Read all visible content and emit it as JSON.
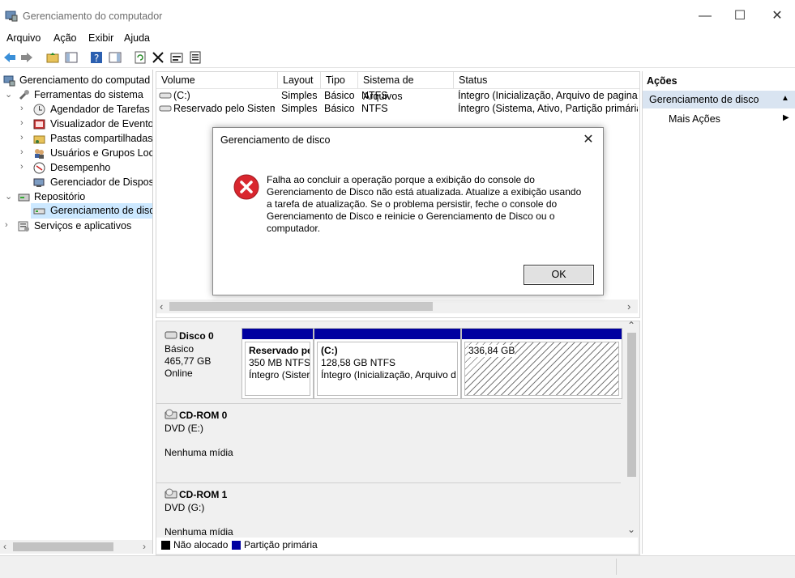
{
  "window": {
    "title": "Gerenciamento do computador",
    "minimize": "—",
    "maximize": "☐",
    "close": "✕"
  },
  "menu": [
    "Arquivo",
    "Ação",
    "Exibir",
    "Ajuda"
  ],
  "tree": {
    "root": "Gerenciamento do computad",
    "tools": "Ferramentas do sistema",
    "scheduler": "Agendador de Tarefas",
    "events": "Visualizador de Eventos",
    "shared": "Pastas compartilhadas",
    "users": "Usuários e Grupos Loca",
    "perf": "Desempenho",
    "devmgr": "Gerenciador de Disposit",
    "storage": "Repositório",
    "diskmgmt": "Gerenciamento de disco",
    "services": "Serviços e aplicativos"
  },
  "list": {
    "columns": [
      "Volume",
      "Layout",
      "Tipo",
      "Sistema de Arquivos",
      "Status"
    ],
    "rows": [
      [
        "(C:)",
        "Simples",
        "Básico",
        "NTFS",
        "Íntegro (Inicialização, Arquivo de paginaçã"
      ],
      [
        "Reservado pelo Sistema",
        "Simples",
        "Básico",
        "NTFS",
        "Íntegro (Sistema, Ativo, Partição primária)"
      ]
    ]
  },
  "disks": {
    "disk0": {
      "name": "Disco 0",
      "type": "Básico",
      "size": "465,77 GB",
      "state": "Online"
    },
    "p_reserved": {
      "title": "Reservado pe",
      "size": "350 MB NTFS",
      "status": "Íntegro (Sister"
    },
    "p_c": {
      "title": "(C:)",
      "size": "128,58 GB NTFS",
      "status": "Íntegro (Inicialização, Arquivo d"
    },
    "p_unalloc": {
      "size": "336,84 GB"
    },
    "cd0": {
      "name": "CD-ROM 0",
      "drive": "DVD (E:)",
      "media": "Nenhuma mídia"
    },
    "cd1": {
      "name": "CD-ROM 1",
      "drive": "DVD (G:)",
      "media": "Nenhuma mídia"
    }
  },
  "legend": {
    "unallocated": "Não alocado",
    "primary": "Partição primária"
  },
  "actions": {
    "header": "Ações",
    "section": "Gerenciamento de disco",
    "more": "Mais Ações"
  },
  "dialog": {
    "title": "Gerenciamento de disco",
    "message": "Falha ao concluir a operação porque a exibição do console do Gerenciamento de Disco não está atualizada. Atualize a exibição usando a tarefa de atualização. Se o problema persistir, feche o console do Gerenciamento de Disco e reinicie o Gerenciamento de Disco ou o computador.",
    "ok": "OK"
  },
  "colors": {
    "primary_partition": "#0000a0",
    "selected_bg": "#cce8ff",
    "section_bg": "#d9e4f1",
    "error_red": "#d9262e"
  }
}
